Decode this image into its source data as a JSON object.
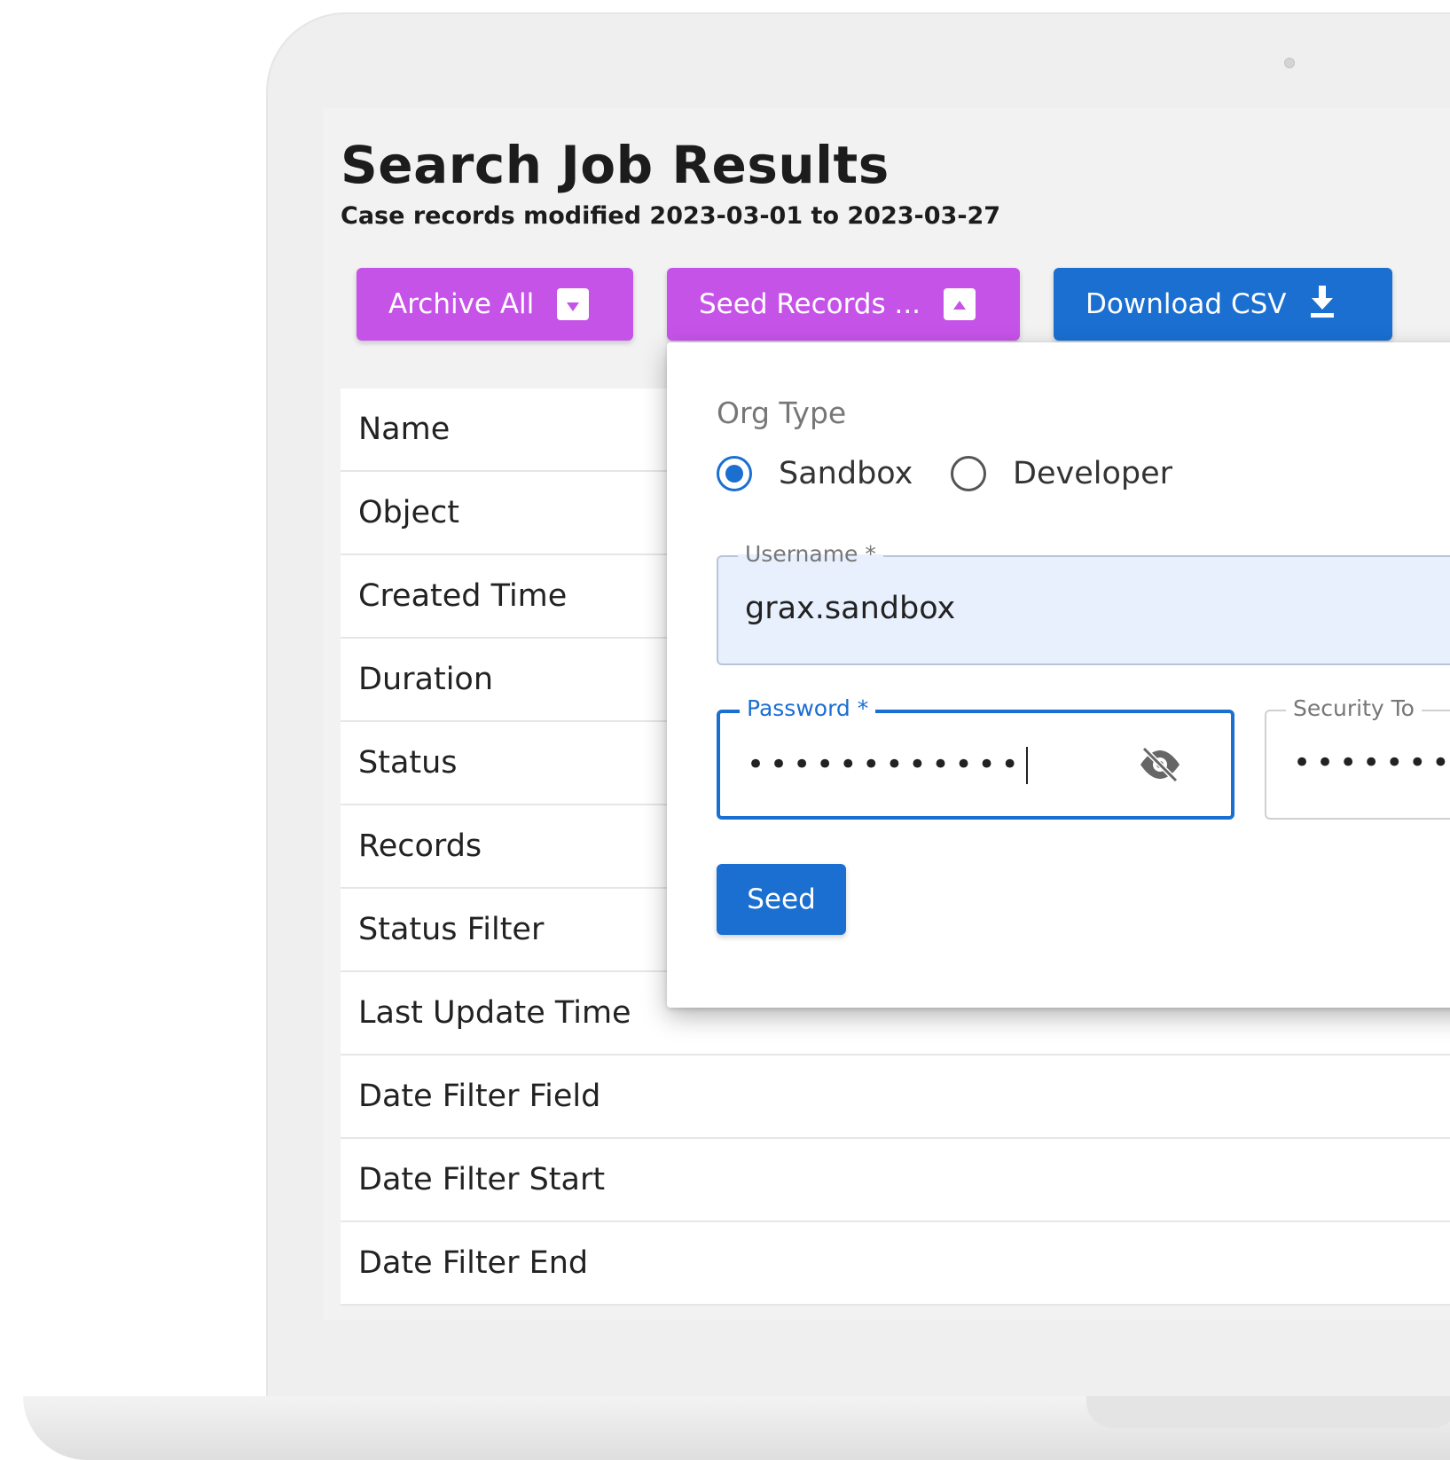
{
  "page": {
    "title": "Search Job Results",
    "subtitle": "Case records modified 2023-03-01 to 2023-03-27"
  },
  "toolbar": {
    "archive_label": "Archive All",
    "seed_label": "Seed Records ...",
    "download_label": "Download CSV"
  },
  "table": {
    "rows": [
      "Name",
      "Object",
      "Created Time",
      "Duration",
      "Status",
      "Records",
      "Status Filter",
      "Last Update Time",
      "Date Filter Field",
      "Date Filter Start",
      "Date Filter End"
    ]
  },
  "seed_form": {
    "org_type_label": "Org Type",
    "options": [
      "Sandbox",
      "Developer"
    ],
    "selected": "Sandbox",
    "username_label": "Username *",
    "username_value": "grax.sandbox",
    "password_label": "Password *",
    "password_mask": "••••••••••••",
    "token_label": "Security To",
    "token_mask": "•••••••",
    "submit_label": "Seed"
  },
  "colors": {
    "purple": "#c653e8",
    "blue": "#1a6fd1",
    "autofill": "#e8f0fe"
  }
}
